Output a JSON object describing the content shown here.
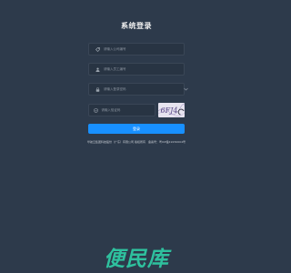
{
  "title": "系统登录",
  "fields": {
    "company": {
      "placeholder": "请输入公司编号"
    },
    "username": {
      "placeholder": "请输入员工编号"
    },
    "password": {
      "placeholder": "请输入登录密码"
    },
    "captcha": {
      "placeholder": "请输入验证码",
      "image_text": "6FJ4"
    }
  },
  "login_label": "登录",
  "footer": "华航云集团科技股份（广东）有限公司 版权所有　备案号：粤ICP备19150004号",
  "watermark": "便民库"
}
